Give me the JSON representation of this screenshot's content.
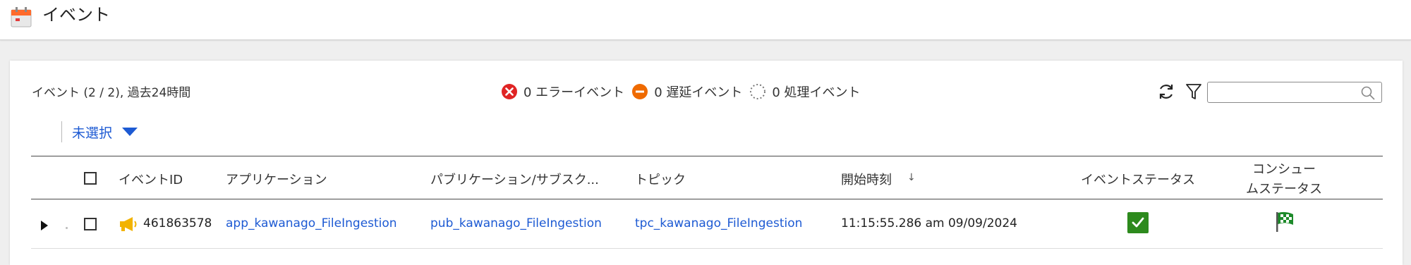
{
  "header": {
    "title": "イベント"
  },
  "summary": {
    "text": "イベント (2 / 2), 過去24時間"
  },
  "legend": {
    "error": {
      "text": "0 エラーイベント",
      "color": "#e02424"
    },
    "delayed": {
      "text": "0 遅延イベント",
      "color": "#ef6a00"
    },
    "processing": {
      "text": "0 処理イベント"
    }
  },
  "toolbar": {
    "search_placeholder": ""
  },
  "selector": {
    "label": "未選択"
  },
  "table": {
    "columns": {
      "event_id": "イベントID",
      "application": "アプリケーション",
      "pub_sub": "パブリケーション/サブスク...",
      "topic": "トピック",
      "start_time": "開始時刻",
      "event_status": "イベントステータス",
      "consume_status_line1": "コンシュー",
      "consume_status_line2": "ムステータス"
    },
    "rows": [
      {
        "event_id": "461863578",
        "application": "app_kawanago_FileIngestion",
        "pub_sub": "pub_kawanago_FileIngestion",
        "topic": "tpc_kawanago_FileIngestion",
        "start_time": "11:15:55.286 am 09/09/2024"
      }
    ]
  },
  "colors": {
    "link": "#1d5ad3",
    "success": "#2d8a1d"
  }
}
